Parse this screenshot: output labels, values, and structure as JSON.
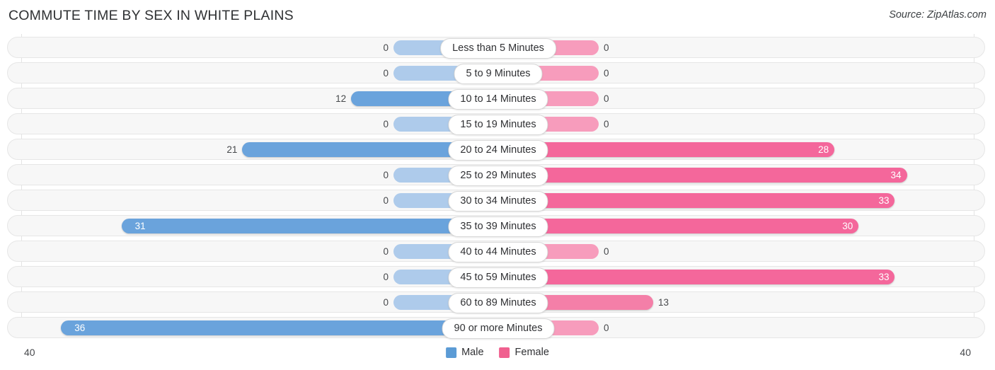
{
  "header": {
    "title": "COMMUTE TIME BY SEX IN WHITE PLAINS",
    "source": "Source: ZipAtlas.com"
  },
  "legend": {
    "items": [
      {
        "label": "Male",
        "color": "#5B9BD5"
      },
      {
        "label": "Female",
        "color": "#F0608F"
      }
    ]
  },
  "axis": {
    "left_label": "40",
    "right_label": "40"
  },
  "colors": {
    "male": "#6AA3DC",
    "male_zero": "#AECBEB",
    "female": "#F4679B",
    "female_zero": "#F79CBC",
    "female_mid": "#F47FA8"
  },
  "chart_data": {
    "type": "bar",
    "title": "COMMUTE TIME BY SEX IN WHITE PLAINS",
    "subtitle": "Source: ZipAtlas.com",
    "orientation": "horizontal",
    "layout": "diverging-bidirectional",
    "xlabel": "",
    "ylabel": "",
    "xlim": [
      40,
      40
    ],
    "grid": false,
    "legend_position": "bottom-center",
    "categories": [
      "Less than 5 Minutes",
      "5 to 9 Minutes",
      "10 to 14 Minutes",
      "15 to 19 Minutes",
      "20 to 24 Minutes",
      "25 to 29 Minutes",
      "30 to 34 Minutes",
      "35 to 39 Minutes",
      "40 to 44 Minutes",
      "45 to 59 Minutes",
      "60 to 89 Minutes",
      "90 or more Minutes"
    ],
    "series": [
      {
        "name": "Male",
        "color": "#5B9BD5",
        "direction": "left",
        "values": [
          0,
          0,
          12,
          0,
          21,
          0,
          0,
          31,
          0,
          0,
          0,
          36
        ]
      },
      {
        "name": "Female",
        "color": "#F0608F",
        "direction": "right",
        "values": [
          0,
          0,
          0,
          0,
          28,
          34,
          33,
          30,
          0,
          33,
          13,
          0
        ]
      }
    ]
  }
}
